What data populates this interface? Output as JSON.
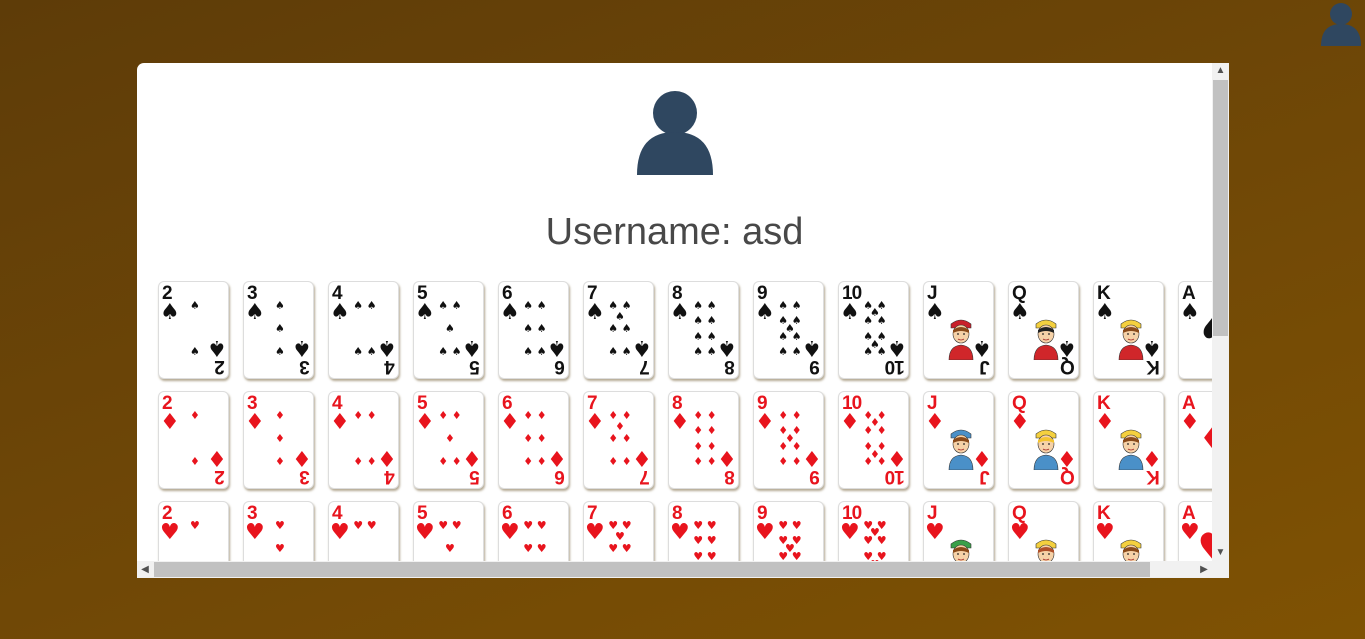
{
  "header": {
    "avatar_icon": "user-silhouette-icon"
  },
  "profile": {
    "avatar_icon": "user-silhouette-icon",
    "username_label": "Username:",
    "username_value": "asd"
  },
  "colors": {
    "avatar": "#2f4760",
    "red_suit": "#e8141d",
    "black_suit": "#111111",
    "background": "#6d4607"
  },
  "card_rows": [
    {
      "suit": "spades",
      "symbol": "♠",
      "color": "black",
      "ranks": [
        "2",
        "3",
        "4",
        "5",
        "6",
        "7",
        "8",
        "9",
        "10",
        "J",
        "Q",
        "K",
        "A"
      ]
    },
    {
      "suit": "diamonds",
      "symbol": "♦",
      "color": "red",
      "ranks": [
        "2",
        "3",
        "4",
        "5",
        "6",
        "7",
        "8",
        "9",
        "10",
        "J",
        "Q",
        "K",
        "A"
      ]
    },
    {
      "suit": "hearts",
      "symbol": "♥",
      "color": "red",
      "ranks": [
        "2",
        "3",
        "4",
        "5",
        "6",
        "7",
        "8",
        "9",
        "10",
        "J",
        "Q",
        "K",
        "A"
      ]
    }
  ],
  "scrollbars": {
    "up_arrow": "▲",
    "down_arrow": "▼",
    "left_arrow": "◀",
    "right_arrow": "▶"
  }
}
